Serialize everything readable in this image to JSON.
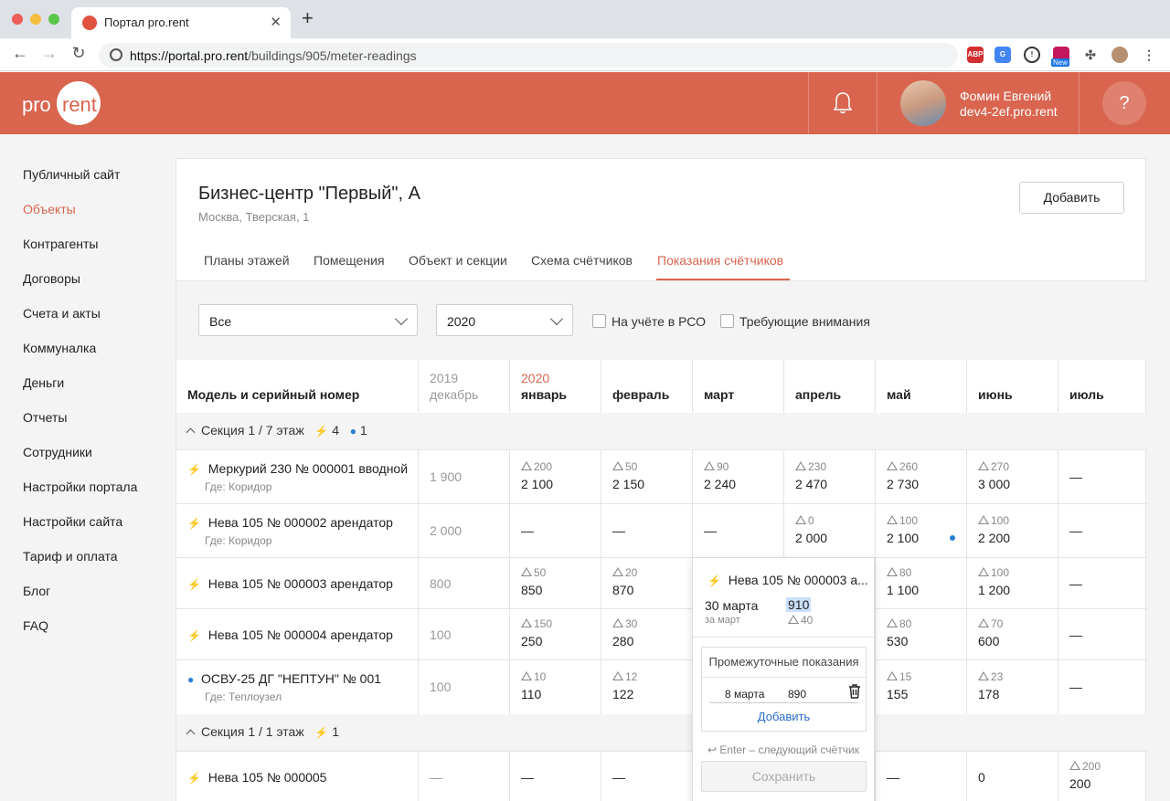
{
  "browser": {
    "tab_title": "Портал pro.rent",
    "tab_close": "✕",
    "new_tab": "+",
    "url_host": "https://portal.pro.rent",
    "url_path": "/buildings/905/meter-readings",
    "ext_abp": "ABP",
    "ext_new": "New"
  },
  "header": {
    "logo_pro": "pro",
    "logo_rent": "rent",
    "user_name": "Фомин Евгений",
    "user_portal": "dev4-2ef.pro.rent",
    "help": "?"
  },
  "sidebar": {
    "items": [
      {
        "label": "Публичный сайт"
      },
      {
        "label": "Объекты"
      },
      {
        "label": "Контрагенты"
      },
      {
        "label": "Договоры"
      },
      {
        "label": "Счета и акты"
      },
      {
        "label": "Коммуналка"
      },
      {
        "label": "Деньги"
      },
      {
        "label": "Отчеты"
      },
      {
        "label": "Сотрудники"
      },
      {
        "label": "Настройки портала"
      },
      {
        "label": "Настройки сайта"
      },
      {
        "label": "Тариф и оплата"
      },
      {
        "label": "Блог"
      },
      {
        "label": "FAQ"
      }
    ],
    "active_index": 1
  },
  "building": {
    "title": "Бизнес-центр \"Первый\", А",
    "address": "Москва, Тверская, 1",
    "add_button": "Добавить"
  },
  "tabs": [
    {
      "label": "Планы этажей"
    },
    {
      "label": "Помещения"
    },
    {
      "label": "Объект и секции"
    },
    {
      "label": "Схема счётчиков"
    },
    {
      "label": "Показания счётчиков"
    }
  ],
  "filters": {
    "type_select": "Все",
    "year_select": "2020",
    "checkbox_rso": "На учёте в РСО",
    "checkbox_attention": "Требующие внимания"
  },
  "table": {
    "col_model": "Модель и серийный номер",
    "prev_year": "2019",
    "prev_month": "декабрь",
    "cur_year": "2020",
    "months": [
      "январь",
      "февраль",
      "март",
      "апрель",
      "май",
      "июнь",
      "июль"
    ],
    "sections": [
      {
        "label": "Секция 1 / 7 этаж",
        "electric": "4",
        "water": "1"
      },
      {
        "label": "Секция 1 / 1 этаж",
        "electric": "1"
      }
    ],
    "rows": [
      {
        "name": "Меркурий 230 № 000001 вводной",
        "where": "Где: Коридор",
        "prev": "1 900",
        "cells": [
          [
            "200",
            "2 100"
          ],
          [
            "50",
            "2 150"
          ],
          [
            "90",
            "2 240"
          ],
          [
            "230",
            "2 470"
          ],
          [
            "260",
            "2 730"
          ],
          [
            "270",
            "3 000"
          ],
          [
            "",
            "—"
          ]
        ]
      },
      {
        "name": "Нева 105 № 000002 арендатор",
        "where": "Где: Коридор",
        "prev": "2 000",
        "cells": [
          [
            "",
            "—"
          ],
          [
            "",
            "—"
          ],
          [
            "",
            "—"
          ],
          [
            "0",
            "2 000"
          ],
          [
            "100",
            "2 100"
          ],
          [
            "100",
            "2 200"
          ],
          [
            "",
            "—"
          ]
        ]
      },
      {
        "name": "Нева 105 № 000003 арендатор",
        "where": "",
        "prev": "800",
        "cells": [
          [
            "50",
            "850"
          ],
          [
            "20",
            "870"
          ],
          [
            "",
            ""
          ],
          [
            "",
            ""
          ],
          [
            "80",
            "1 100"
          ],
          [
            "100",
            "1 200"
          ],
          [
            "",
            "—"
          ]
        ]
      },
      {
        "name": "Нева 105 № 000004 арендатор",
        "where": "",
        "prev": "100",
        "cells": [
          [
            "150",
            "250"
          ],
          [
            "30",
            "280"
          ],
          [
            "",
            ""
          ],
          [
            "",
            ""
          ],
          [
            "80",
            "530"
          ],
          [
            "70",
            "600"
          ],
          [
            "",
            "—"
          ]
        ]
      },
      {
        "name": "ОСВУ-25 ДГ \"НЕПТУН\" № 001",
        "where": "Где: Теплоузел",
        "prev": "100",
        "cells": [
          [
            "10",
            "110"
          ],
          [
            "12",
            "122"
          ],
          [
            "",
            ""
          ],
          [
            "",
            ""
          ],
          [
            "15",
            "155"
          ],
          [
            "23",
            "178"
          ],
          [
            "",
            "—"
          ]
        ]
      },
      {
        "name": "Нева 105 № 000005",
        "where": "",
        "prev": "—",
        "cells": [
          [
            "",
            "—"
          ],
          [
            "",
            "—"
          ],
          [
            "",
            ""
          ],
          [
            "",
            ""
          ],
          [
            "",
            "—"
          ],
          [
            "",
            "0"
          ],
          [
            "200",
            "200"
          ]
        ]
      }
    ]
  },
  "popup": {
    "title": "Нева 105 № 000003 а...",
    "date": "30 марта",
    "for_month": "за март",
    "value": "910",
    "delta": "40",
    "interim_title": "Промежуточные показания",
    "interim_date": "8 марта",
    "interim_value": "890",
    "interim_add": "Добавить",
    "hint": "↩ Enter – следующий счётчик",
    "save": "Сохранить"
  },
  "colors": {
    "brand": "#d9654f",
    "electric": "#f0a020",
    "water": "#2a7fd4"
  }
}
